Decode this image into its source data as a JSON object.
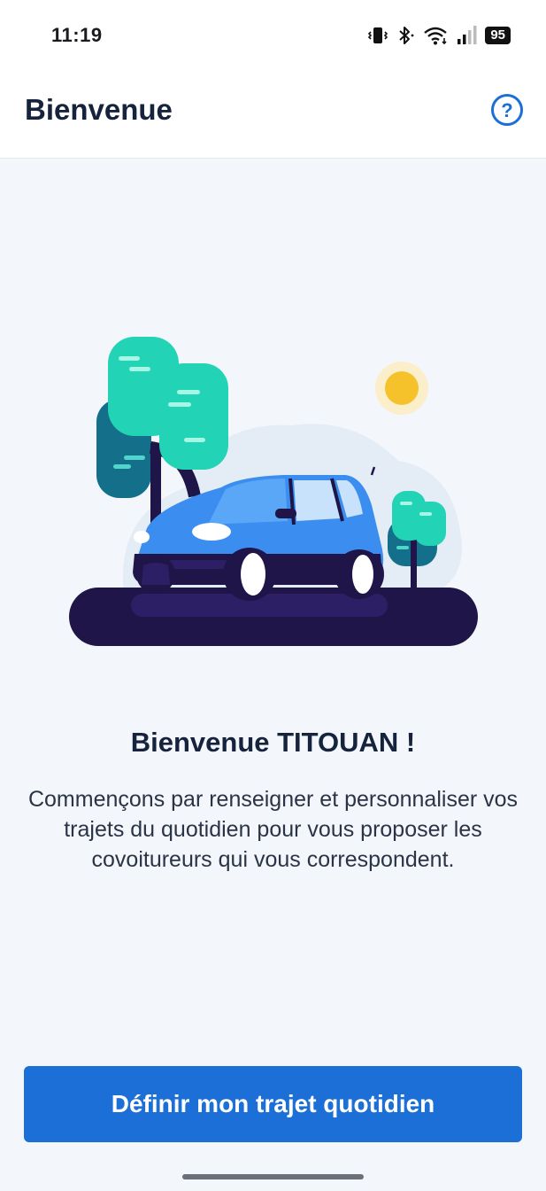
{
  "status_bar": {
    "time": "11:19",
    "battery": "95",
    "icons": [
      "vibrate-icon",
      "bluetooth-icon",
      "wifi-icon",
      "signal-icon",
      "battery-icon"
    ]
  },
  "app_bar": {
    "title": "Bienvenue",
    "help_icon": "help-circle-icon",
    "help_glyph": "?"
  },
  "illustration": {
    "subject": "car-illustration",
    "colors": {
      "car": "#3b8df0",
      "tree_light": "#22d3b5",
      "tree_dark": "#14708a",
      "road": "#1f1548",
      "sun": "#f5c22b"
    }
  },
  "content": {
    "welcome_title": "Bienvenue TITOUAN !",
    "welcome_text": "Commençons par renseigner et personnaliser vos trajets du quotidien pour vous proposer les covoitureurs qui vous correspondent."
  },
  "actions": {
    "primary_label": "Définir mon trajet quotidien"
  },
  "colors": {
    "accent": "#1b6fd6",
    "title_text": "#16233d",
    "background": "#f3f6fb"
  }
}
